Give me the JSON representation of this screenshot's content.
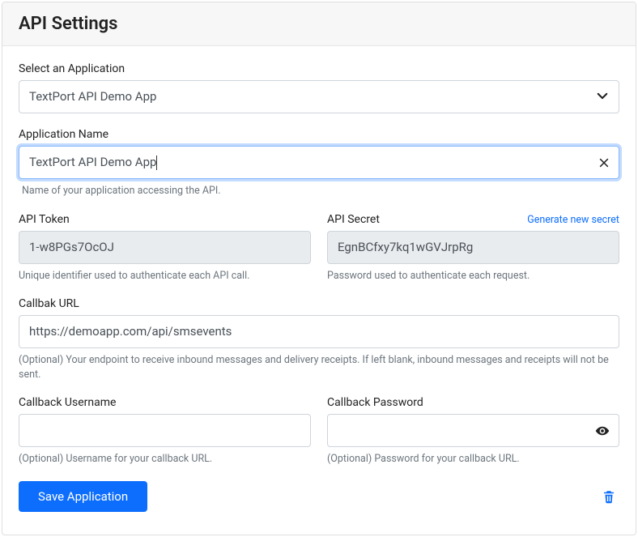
{
  "header": {
    "title": "API Settings"
  },
  "selectApp": {
    "label": "Select an Application",
    "value": "TextPort API Demo App"
  },
  "appName": {
    "label": "Application Name",
    "value": "TextPort API Demo App",
    "hint": "Name of your application accessing the API."
  },
  "apiToken": {
    "label": "API Token",
    "value": "1-w8PGs7OcOJ",
    "hint": "Unique identifier used to authenticate each API call."
  },
  "apiSecret": {
    "label": "API Secret",
    "value": "EgnBCfxy7kq1wGVJrpRg",
    "link": "Generate new secret",
    "hint": "Password used to authenticate each request."
  },
  "callbackUrl": {
    "label": "Callbak URL",
    "value": "https://demoapp.com/api/smsevents",
    "hint": "(Optional) Your endpoint to receive inbound messages and delivery receipts. If left blank, inbound messages and receipts will not be sent."
  },
  "callbackUser": {
    "label": "Callback Username",
    "value": "",
    "hint": "(Optional) Username for your callback URL."
  },
  "callbackPass": {
    "label": "Callback Password",
    "value": "",
    "hint": "(Optional) Password for your callback URL."
  },
  "actions": {
    "save": "Save Application"
  }
}
